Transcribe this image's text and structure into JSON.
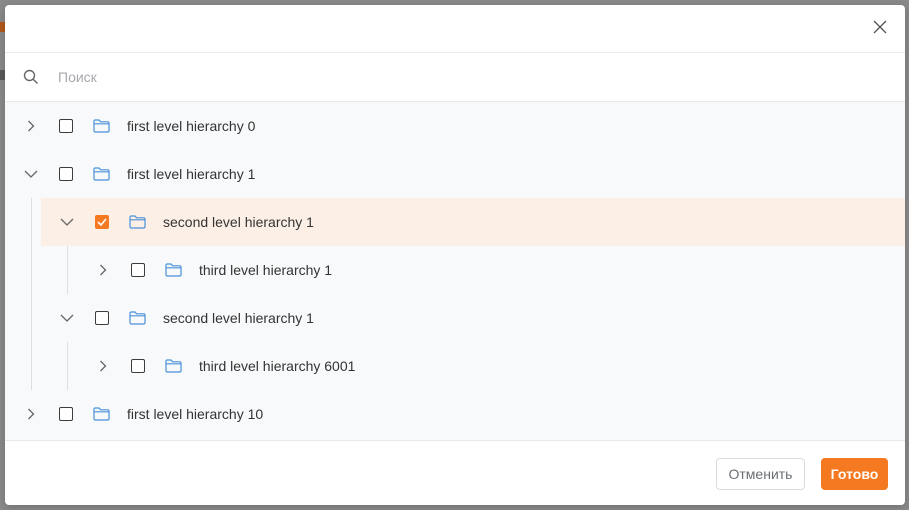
{
  "search": {
    "placeholder": "Поиск"
  },
  "colors": {
    "accent": "#f47920",
    "folder": "#4a90d9",
    "selected_row": "#fcefe6"
  },
  "tree": {
    "nodes": [
      {
        "label": "first level hierarchy 0",
        "level": 1,
        "expanded": false,
        "checked": false,
        "icon": "folder-icon"
      },
      {
        "label": "first level hierarchy 1",
        "level": 1,
        "expanded": true,
        "checked": false,
        "icon": "folder-icon"
      },
      {
        "label": "second level hierarchy 1",
        "level": 2,
        "expanded": true,
        "checked": true,
        "selected": true,
        "icon": "folder-icon"
      },
      {
        "label": "third level hierarchy 1",
        "level": 3,
        "expanded": false,
        "checked": false,
        "icon": "folder-icon"
      },
      {
        "label": "second level hierarchy 1",
        "level": 2,
        "expanded": true,
        "checked": false,
        "icon": "folder-icon"
      },
      {
        "label": "third level hierarchy 6001",
        "level": 3,
        "expanded": false,
        "checked": false,
        "icon": "folder-icon"
      },
      {
        "label": "first level hierarchy 10",
        "level": 1,
        "expanded": false,
        "checked": false,
        "icon": "folder-icon"
      }
    ]
  },
  "footer": {
    "cancel_label": "Отменить",
    "done_label": "Готово"
  },
  "icons": {
    "close": "close-icon",
    "search": "search-icon"
  }
}
